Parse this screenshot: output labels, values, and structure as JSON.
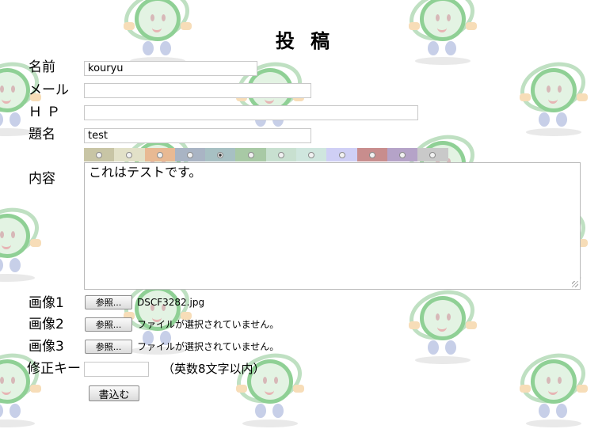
{
  "form": {
    "title": "投 稿",
    "name_label": "名前",
    "name_value": "kouryu",
    "email_label": "メール",
    "email_value": "",
    "hp_label": "ＨＰ",
    "hp_value": "",
    "subject_label": "題名",
    "subject_value": "test",
    "content_label": "内容",
    "content_value": "これはテストです。",
    "colors": [
      "#c8c5a5",
      "#e2e1c8",
      "#e8b993",
      "#a9b4c4",
      "#a7c0c3",
      "#a8c9a5",
      "#c8e0d0",
      "#cfe6de",
      "#cfcff5",
      "#c88d8d",
      "#b5a3c8",
      "#c9c9c9"
    ],
    "selected_color_index": 4,
    "image1_label": "画像1",
    "image2_label": "画像2",
    "image3_label": "画像3",
    "browse_label": "参照...",
    "image1_file": "DSCF3282.jpg",
    "image2_file": "ファイルが選択されていません。",
    "image3_file": "ファイルが選択されていません。",
    "key_label": "修正キー",
    "key_value": "",
    "key_hint": "（英数8文字以内）",
    "submit_label": "書込む"
  }
}
